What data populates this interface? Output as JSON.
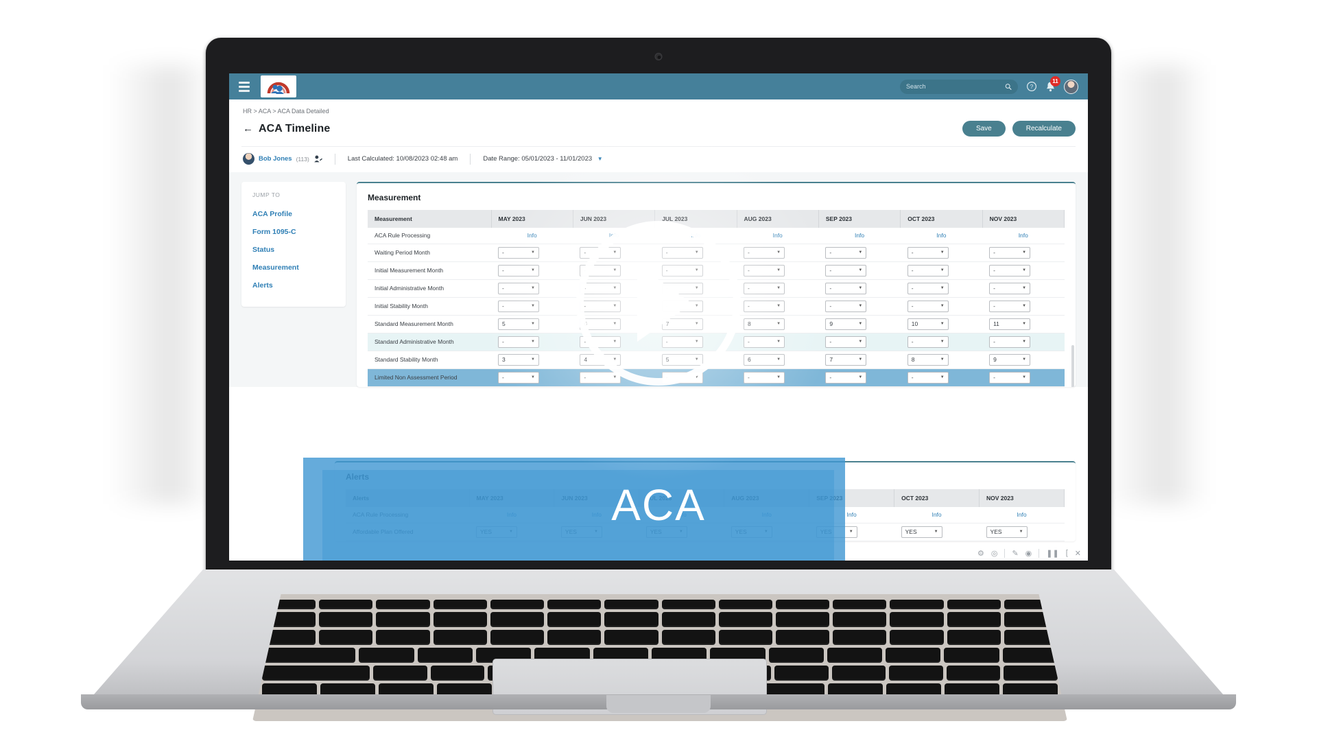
{
  "topbar": {
    "menu_icon": "hamburger-icon",
    "logo_alt": "company-logo",
    "search": {
      "placeholder": "Search",
      "value": ""
    },
    "help_icon": "help-circle-icon",
    "bell_icon": "bell-icon",
    "notification_count": "11",
    "avatar_alt": "user-avatar"
  },
  "breadcrumb": "HR > ACA > ACA Data Detailed",
  "header": {
    "back_icon": "back-arrow-icon",
    "title": "ACA Timeline",
    "save_label": "Save",
    "recalculate_label": "Recalculate"
  },
  "infobar": {
    "person_name": "Bob Jones",
    "person_id": "(113)",
    "person_icon": "person-switch-icon",
    "last_calculated": "Last Calculated: 10/08/2023 02:48 am",
    "date_range": "Date Range: 05/01/2023 - 11/01/2023",
    "date_caret": "chevron-down-icon"
  },
  "jump_to": {
    "label": "JUMP TO",
    "items": [
      {
        "label": "ACA Profile"
      },
      {
        "label": "Form 1095-C"
      },
      {
        "label": "Status"
      },
      {
        "label": "Measurement"
      },
      {
        "label": "Alerts"
      }
    ]
  },
  "measurement": {
    "panel_title": "Measurement",
    "columns": [
      "Measurement",
      "MAY 2023",
      "JUN 2023",
      "JUL 2023",
      "AUG 2023",
      "SEP 2023",
      "OCT 2023",
      "NOV 2023"
    ],
    "rows": [
      {
        "label": "ACA Rule Processing",
        "type": "link",
        "values": [
          "Info",
          "Info",
          "Info",
          "Info",
          "Info",
          "Info",
          "Info"
        ]
      },
      {
        "label": "Waiting Period Month",
        "type": "select",
        "values": [
          "-",
          "-",
          "-",
          "-",
          "-",
          "-",
          "-"
        ]
      },
      {
        "label": "Initial Measurement Month",
        "type": "select",
        "values": [
          "-",
          "-",
          "-",
          "-",
          "-",
          "-",
          "-"
        ]
      },
      {
        "label": "Initial Administrative Month",
        "type": "select",
        "values": [
          "-",
          "-",
          "-",
          "-",
          "-",
          "-",
          "-"
        ]
      },
      {
        "label": "Initial Stability Month",
        "type": "select",
        "values": [
          "-",
          "-",
          "-",
          "-",
          "-",
          "-",
          "-"
        ]
      },
      {
        "label": "Standard Measurement Month",
        "type": "select",
        "values": [
          "5",
          "6",
          "7",
          "8",
          "9",
          "10",
          "11"
        ]
      },
      {
        "label": "Standard Administrative Month",
        "type": "select",
        "highlight": true,
        "values": [
          "-",
          "-",
          "-",
          "-",
          "-",
          "-",
          "-"
        ]
      },
      {
        "label": "Standard Stability Month",
        "type": "select",
        "values": [
          "3",
          "4",
          "5",
          "6",
          "7",
          "8",
          "9"
        ]
      },
      {
        "label": "Limited Non Assessment Period",
        "type": "select",
        "values": [
          "-",
          "-",
          "-",
          "-",
          "-",
          "-",
          "-"
        ]
      }
    ]
  },
  "alerts": {
    "panel_title": "Alerts",
    "columns": [
      "Alerts",
      "MAY 2023",
      "JUN 2023",
      "JUL 2023",
      "AUG 2023",
      "SEP 2023",
      "OCT 2023",
      "NOV 2023"
    ],
    "rows": [
      {
        "label": "ACA Rule Processing",
        "type": "link",
        "values": [
          "Info",
          "Info",
          "Info",
          "Info",
          "Info",
          "Info",
          "Info"
        ]
      },
      {
        "label": "Affordable Plan Offered",
        "type": "select",
        "values": [
          "YES",
          "YES",
          "YES",
          "YES",
          "YES",
          "YES",
          "YES"
        ]
      }
    ]
  },
  "overlay": {
    "play_icon": "play-button-icon",
    "watermark": "ACA"
  },
  "video_controls": {
    "items": [
      "settings-icon",
      "target-icon",
      "pen-icon",
      "camera-icon",
      "pause-icon",
      "bracket-icon",
      "close-icon"
    ]
  },
  "colors": {
    "brand_teal": "#45809a",
    "accent_blue": "#2f7fb5",
    "badge_red": "#e02b26",
    "overlay_blue": "#3e96d2"
  }
}
